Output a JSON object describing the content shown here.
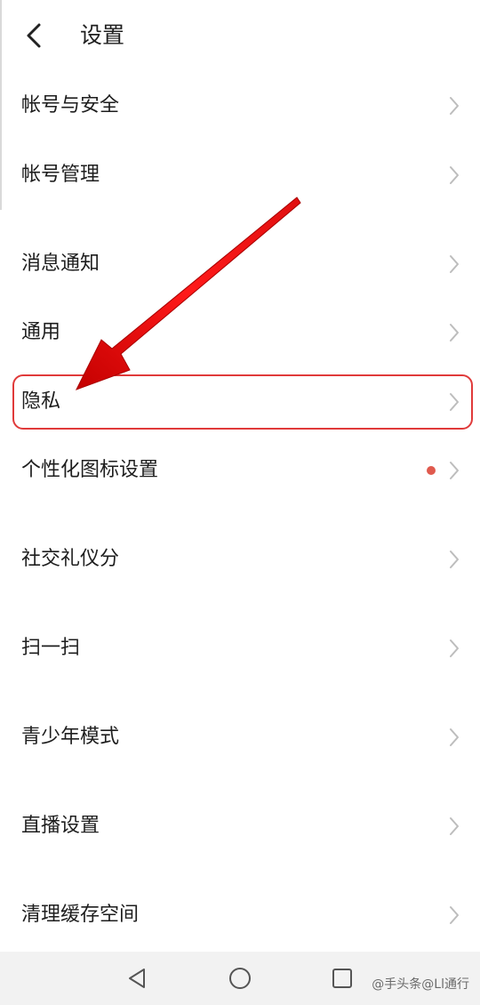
{
  "header": {
    "title": "设置"
  },
  "settings": {
    "items": [
      {
        "label": "帐号与安全"
      },
      {
        "label": "帐号管理"
      },
      {
        "label": "消息通知"
      },
      {
        "label": "通用"
      },
      {
        "label": "隐私"
      },
      {
        "label": "个性化图标设置"
      },
      {
        "label": "社交礼仪分"
      },
      {
        "label": "扫一扫"
      },
      {
        "label": "青少年模式"
      },
      {
        "label": "直播设置"
      },
      {
        "label": "清理缓存空间"
      }
    ]
  },
  "icons": {
    "back": "chevron-left-icon",
    "row_arrow": "chevron-right-icon",
    "nav_back": "triangle-back-icon",
    "nav_home": "circle-home-icon",
    "nav_recent": "square-recent-icon"
  },
  "colors": {
    "annotation": "#e02020",
    "badge_dot": "#e05a4e",
    "chevron": "#bdbdbd",
    "navbar_bg": "#f2f2f2"
  },
  "navbar": {
    "watermark": "@手头条@Ll通行"
  }
}
